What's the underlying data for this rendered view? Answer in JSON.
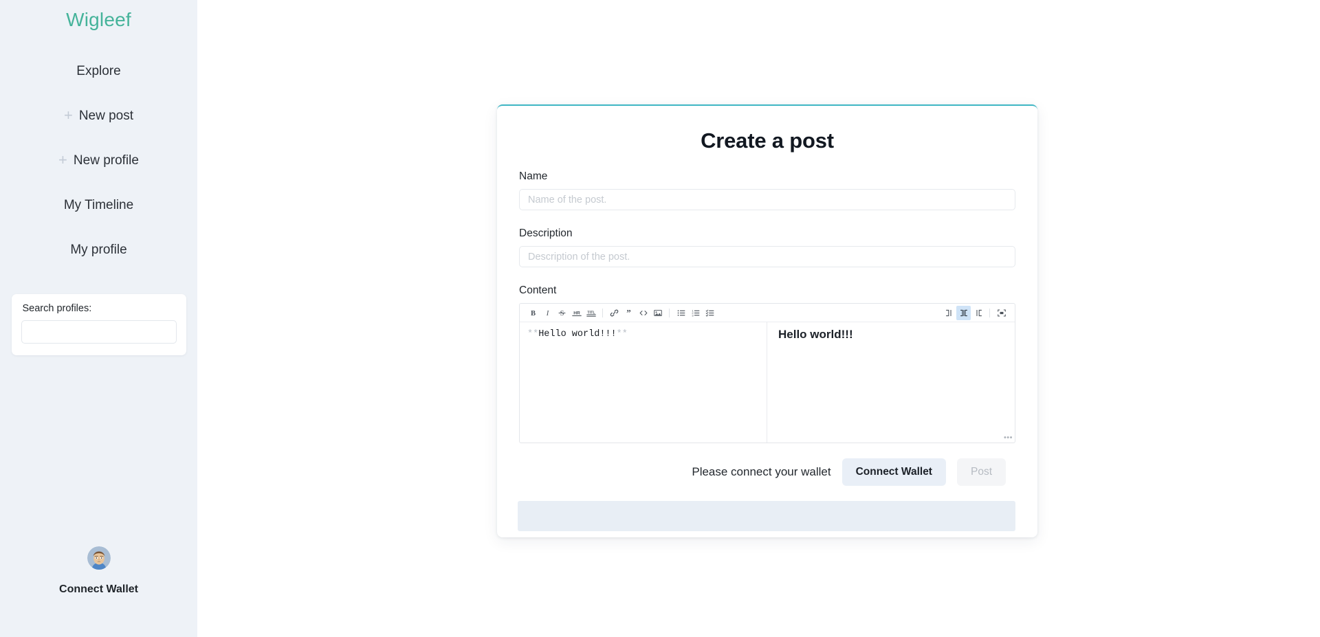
{
  "sidebar": {
    "brand": "Wigleef",
    "items": [
      {
        "label": "Explore",
        "icon": ""
      },
      {
        "label": "New post",
        "icon": "plus-icon"
      },
      {
        "label": "New profile",
        "icon": "plus-icon"
      },
      {
        "label": "My Timeline",
        "icon": ""
      },
      {
        "label": "My profile",
        "icon": ""
      }
    ],
    "search": {
      "label": "Search profiles:",
      "value": "",
      "placeholder": ""
    },
    "bottom": {
      "avatar_icon": "user-avatar",
      "wallet_label": "Connect Wallet"
    }
  },
  "card": {
    "title": "Create a post",
    "accent_color": "#3fb6c4",
    "name_field": {
      "label": "Name",
      "value": "",
      "placeholder": "Name of the post."
    },
    "description_field": {
      "label": "Description",
      "value": "",
      "placeholder": "Description of the post."
    },
    "content_field": {
      "label": "Content",
      "markdown_source": "**Hello world!!!**",
      "markdown_mark_open": "**",
      "markdown_text": "Hello world!!!",
      "markdown_mark_close": "**",
      "preview_text": "Hello world!!!",
      "resize_handle": "•••"
    },
    "toolbar": {
      "left": [
        {
          "name": "bold-icon",
          "label": "B"
        },
        {
          "name": "italic-icon",
          "label": "I"
        },
        {
          "name": "strikethrough-icon",
          "label": "S"
        },
        {
          "name": "horizontal-rule-icon",
          "label": "HR"
        },
        {
          "name": "title-icon",
          "label": "TITL"
        },
        {
          "name": "link-icon",
          "label": "link"
        },
        {
          "name": "quote-icon",
          "label": "”"
        },
        {
          "name": "code-icon",
          "label": "</>"
        },
        {
          "name": "image-icon",
          "label": "image"
        },
        {
          "name": "unordered-list-icon",
          "label": "ul"
        },
        {
          "name": "ordered-list-icon",
          "label": "ol"
        },
        {
          "name": "checked-list-icon",
          "label": "checklist"
        }
      ],
      "right": [
        {
          "name": "edit-mode-icon",
          "active": false
        },
        {
          "name": "split-view-icon",
          "active": true
        },
        {
          "name": "preview-mode-icon",
          "active": false
        },
        {
          "name": "fullscreen-icon",
          "active": false
        }
      ],
      "active_color": "#cfe3f7"
    },
    "actions": {
      "message": "Please connect your wallet",
      "connect_label": "Connect Wallet",
      "post_label": "Post",
      "post_disabled": true
    }
  }
}
